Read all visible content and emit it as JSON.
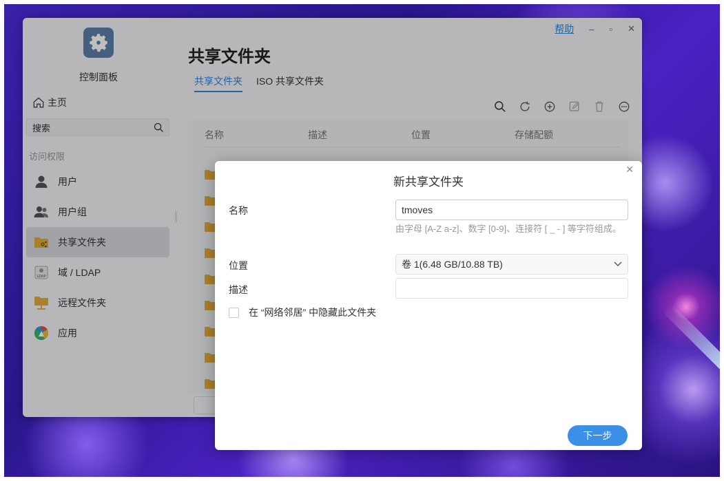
{
  "app": {
    "title": "控制面板",
    "home_label": "主页",
    "search_placeholder": "搜索",
    "section_label": "访问权限"
  },
  "sidebar": {
    "items": [
      {
        "label": "用户",
        "icon": "user-icon"
      },
      {
        "label": "用户组",
        "icon": "user-group-icon"
      },
      {
        "label": "共享文件夹",
        "icon": "shared-folder-icon",
        "active": true
      },
      {
        "label": "域 / LDAP",
        "icon": "ldap-icon"
      },
      {
        "label": "远程文件夹",
        "icon": "remote-folder-icon"
      },
      {
        "label": "应用",
        "icon": "app-icon"
      }
    ]
  },
  "header": {
    "title": "共享文件夹",
    "help": "帮助",
    "tabs": [
      {
        "label": "共享文件夹",
        "active": true
      },
      {
        "label": "ISO 共享文件夹",
        "active": false
      }
    ]
  },
  "table": {
    "columns": [
      "名称",
      "描述",
      "位置",
      "存储配额"
    ]
  },
  "dialog": {
    "title": "新共享文件夹",
    "name_label": "名称",
    "name_value": "tmoves",
    "name_hint": "由字母 [A-Z a-z]、数字 [0-9]、连接符 [ _ - ] 等字符组成。",
    "location_label": "位置",
    "location_value": "卷 1(6.48 GB/10.88 TB)",
    "description_label": "描述",
    "description_value": "",
    "hide_label": "在 “网络邻居” 中隐藏此文件夹",
    "next_label": "下一步"
  },
  "colors": {
    "accent": "#2f85d8",
    "button": "#3c8fe6",
    "folder": "#e3ac3a"
  }
}
